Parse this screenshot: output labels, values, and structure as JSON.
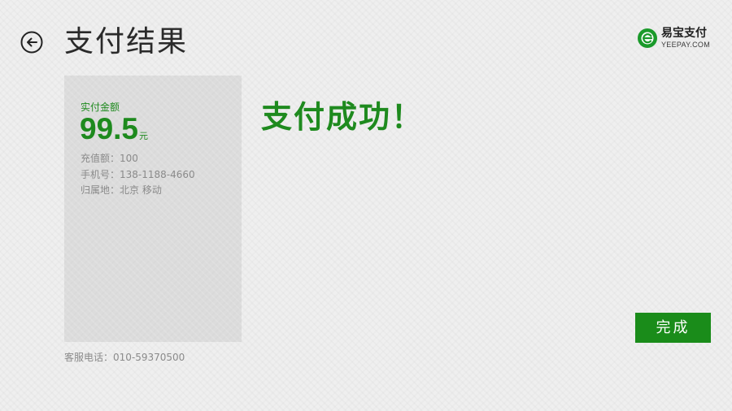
{
  "header": {
    "title": "支付结果",
    "back_icon": "back-arrow-icon"
  },
  "brand": {
    "name": "易宝支付",
    "url": "YEEPAY.COM",
    "logo_icon": "yeepay-logo-icon",
    "color": "#1a9a2a"
  },
  "summary": {
    "amount_label": "实付金额",
    "amount_value": "99.5",
    "amount_unit": "元",
    "topup": "充值额：100",
    "phone": "手机号：138-1188-4660",
    "region": "归属地：北京 移动"
  },
  "status": {
    "message": "支付成功！"
  },
  "footer": {
    "hotline": "客服电话：010-59370500"
  },
  "actions": {
    "done_label": "完成"
  },
  "colors": {
    "accent": "#1a8c1a",
    "text_primary": "#2a2a2a",
    "text_muted": "#8a8a8a",
    "background": "#efefef",
    "card": "#dcdcdc"
  }
}
